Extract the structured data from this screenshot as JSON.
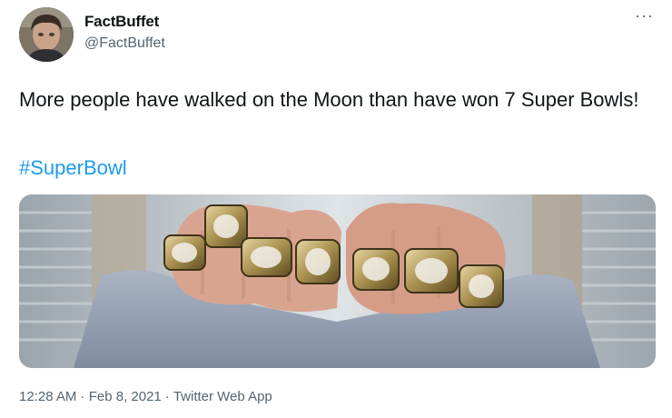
{
  "tweet": {
    "author": {
      "display_name": "FactBuffet",
      "handle": "@FactBuffet",
      "avatar_icon": "user-avatar-photo"
    },
    "more_icon": "more-options-icon",
    "text": "More people have walked on the Moon than have won 7 Super Bowls!",
    "hashtag": "#SuperBowl",
    "media": {
      "description_icon": "hands-with-super-bowl-rings-photo"
    },
    "meta": "12:28 AM · Feb 8, 2021 · Twitter Web App"
  },
  "colors": {
    "text": "#0f1419",
    "secondary": "#536471",
    "link": "#1d9bf0"
  }
}
